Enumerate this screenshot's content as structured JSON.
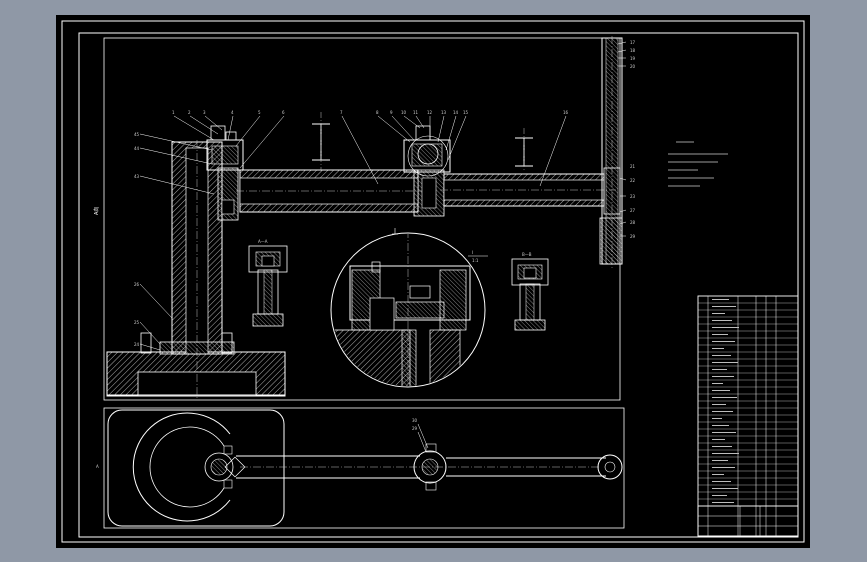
{
  "colors": {
    "desktop_bg": "#8f98a6",
    "sheet_bg": "#000000",
    "line_primary": "#ffffff",
    "line_hidden": "#bfbfbf",
    "hatch": "#d9d9d9"
  },
  "drawing": {
    "section_label_scale": "1:1",
    "part_balloons": [
      "1",
      "2",
      "3",
      "4",
      "5",
      "6",
      "7",
      "8",
      "9",
      "10",
      "11",
      "12",
      "13",
      "14",
      "15",
      "16",
      "17",
      "18",
      "19",
      "20",
      "21",
      "22",
      "23",
      "24",
      "25",
      "26",
      "27",
      "28",
      "29",
      "30"
    ]
  }
}
